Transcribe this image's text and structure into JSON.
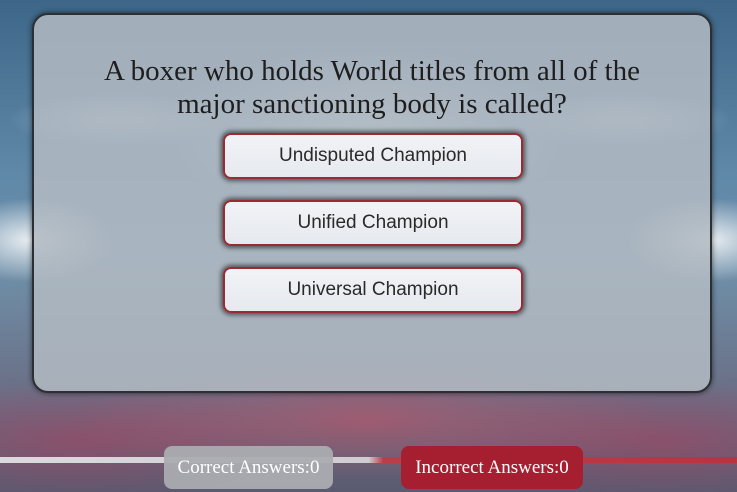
{
  "quiz": {
    "question": "A boxer who holds World titles from all of the major sanctioning body is called?",
    "answers": [
      {
        "label": "Undisputed Champion"
      },
      {
        "label": "Unified Champion"
      },
      {
        "label": "Universal Champion"
      }
    ]
  },
  "score": {
    "correct_label": "Correct Answers:0",
    "incorrect_label": "Incorrect Answers:0"
  },
  "colors": {
    "answer_border": "#9a2a34",
    "incorrect_bg": "#a61f31",
    "correct_bg": "#aaacb0"
  }
}
